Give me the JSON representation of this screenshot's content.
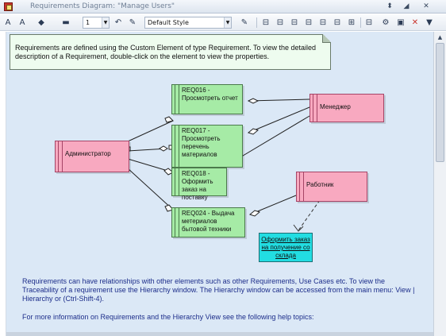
{
  "window": {
    "title": "Requirements Diagram: \"Manage Users\"",
    "controls": [
      "⬍",
      "◢",
      "✕"
    ]
  },
  "toolbar": {
    "line_width_value": "1",
    "style_value": "Default Style",
    "buttons": [
      "A",
      "A",
      "◆",
      "▬",
      "↶",
      "✎",
      "✎",
      "⊟",
      "⊟",
      "⊟",
      "⊟",
      "⊟",
      "⊟",
      "⊞",
      "⊟",
      "⚙",
      "▣",
      "✕",
      "▼"
    ]
  },
  "note": {
    "text": "Requirements are defined using the Custom Element of type Requirement.  To view the detailed description of a Requirement, double-click on the element to view the properties."
  },
  "diagram": {
    "actors": [
      {
        "id": "admin",
        "label": "Администратор"
      },
      {
        "id": "manager",
        "label": "Менеджер"
      },
      {
        "id": "worker",
        "label": "Работник"
      }
    ],
    "requirements": [
      {
        "id": "r16",
        "label": "REQ016 - Просмотреть отчет"
      },
      {
        "id": "r17",
        "label": "REQ017 - Просмотреть перечень материалов"
      },
      {
        "id": "r18",
        "label": "REQ018 - Оформить заказ на поставку"
      },
      {
        "id": "r24",
        "label": "REQ024 - Выдача метериалов бытовой техники"
      }
    ],
    "task": {
      "label": "Оформить заказ на получение со склада"
    }
  },
  "body": {
    "paragraph1": "Requirements can have relationships with other elements such as other Requirements,  Use Cases etc.  To view the Traceability of a requirement use the Hierarchy window. The Hierarchy window can be accessed from the main menu:  View | Hierarchy  or (Ctrl-Shift-4).",
    "paragraph2": "For more information on Requirements and the Hierarchy View see the following help topics:"
  }
}
